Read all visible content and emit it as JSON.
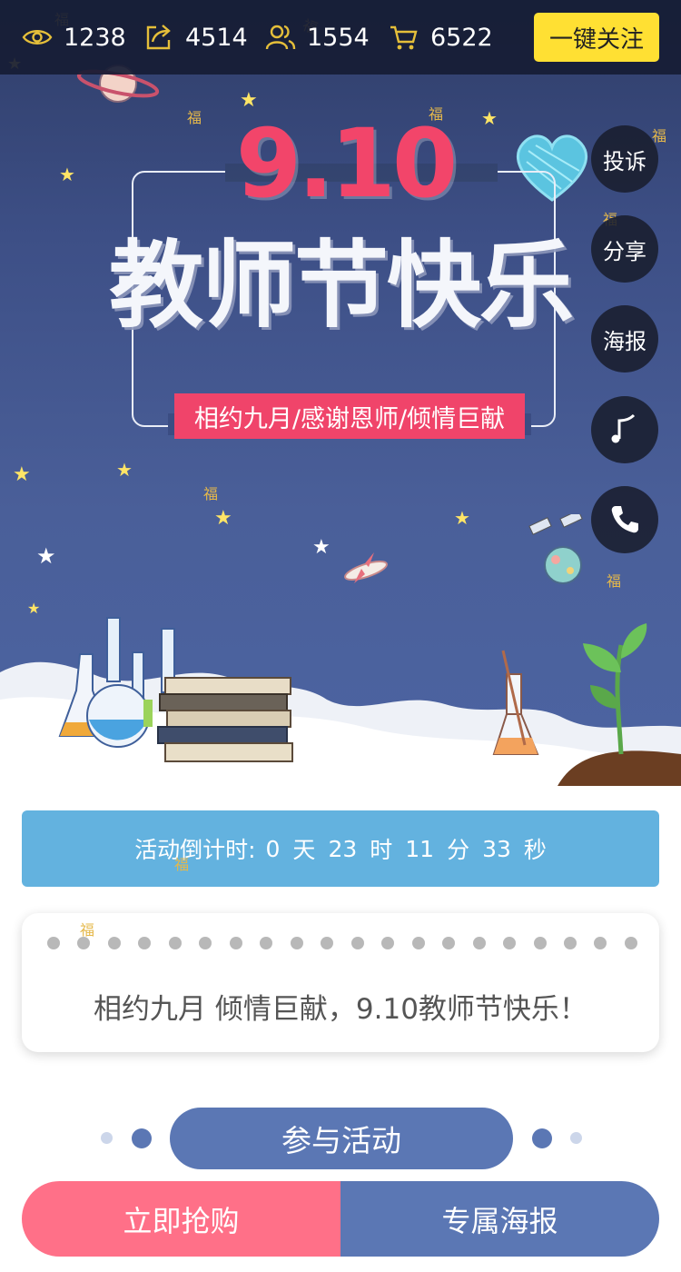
{
  "stats": {
    "views": "1238",
    "shares": "4514",
    "users": "1554",
    "orders": "6522",
    "follow_label": "一键关注"
  },
  "banner": {
    "date": "9.10",
    "title": "教师节快乐",
    "slogan": "相约九月/感谢恩师/倾情巨献",
    "decor_char": "福"
  },
  "side_menu": {
    "complaint": "投诉",
    "share": "分享",
    "poster": "海报"
  },
  "countdown": {
    "label": "活动倒计时:",
    "days": "0",
    "days_unit": "天",
    "hours": "23",
    "hours_unit": "时",
    "minutes": "11",
    "minutes_unit": "分",
    "seconds": "33",
    "seconds_unit": "秒"
  },
  "message": {
    "text": "相约九月 倾情巨献，9.10教师节快乐！"
  },
  "join": {
    "label": "参与活动"
  },
  "bottom_bar": {
    "buy_label": "立即抢购",
    "poster_label": "专属海报"
  },
  "colors": {
    "accent_yellow": "#ffe033",
    "countdown_blue": "#63b2df",
    "primary_blue": "#5b77b4",
    "pink": "#ff7088",
    "slogan_red": "#f0446a"
  }
}
